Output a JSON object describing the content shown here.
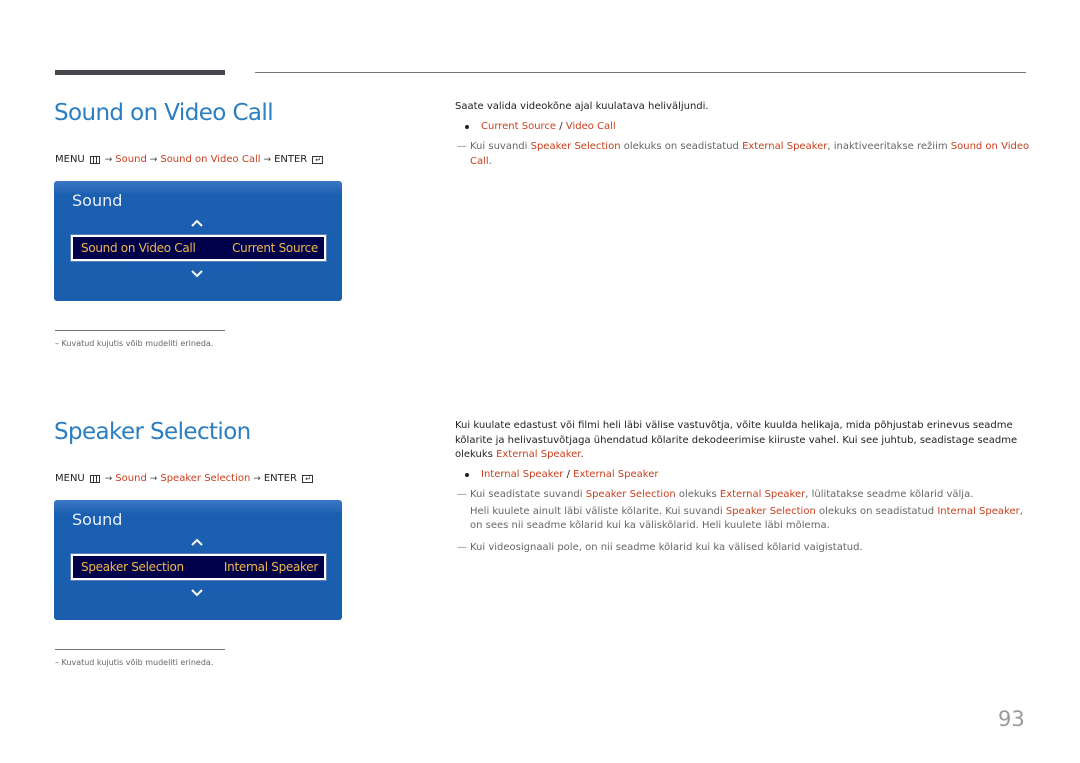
{
  "section1": {
    "title": "Sound on Video Call",
    "menu_path": {
      "menu": "MENU",
      "step1": "Sound",
      "step2": "Sound on Video Call",
      "enter": "ENTER"
    },
    "osd": {
      "title": "Sound",
      "item_label": "Sound on Video Call",
      "item_value": "Current Source"
    },
    "footnote": "–  Kuvatud kujutis võib mudeliti erineda.",
    "description": "Saate valida videokõne ajal kuulatava heliväljundi.",
    "options": [
      "Current Source",
      "Video Call"
    ],
    "options_sep": " / ",
    "note": {
      "p1": "Kui suvandi ",
      "h1": "Speaker Selection",
      "p2": " olekuks on seadistatud ",
      "h2": "External Speaker",
      "p3": ", inaktiveeritakse režiim ",
      "h3a": "Sound on Video",
      "h3b": "Call",
      "p4": "."
    }
  },
  "section2": {
    "title": "Speaker Selection",
    "menu_path": {
      "menu": "MENU",
      "step1": "Sound",
      "step2": "Speaker Selection",
      "enter": "ENTER"
    },
    "osd": {
      "title": "Sound",
      "item_label": "Speaker Selection",
      "item_value": "Internal Speaker"
    },
    "footnote": "–  Kuvatud kujutis võib mudeliti erineda.",
    "description": {
      "line1": "Kui kuulate edastust või filmi heli läbi välise vastuvõtja, võite kuulda helikaja, mida põhjustab erinevus seadme",
      "line2": "kõlarite ja helivastuvõtjaga ühendatud kõlarite dekodeerimise kiiruste vahel. Kui see juhtub, seadistage seadme",
      "line3_pre": "olekuks ",
      "line3_hl": "External Speaker",
      "line3_post": "."
    },
    "options": [
      "Internal Speaker",
      "External Speaker"
    ],
    "options_sep": " / ",
    "note1": {
      "p1": "Kui seadistate suvandi ",
      "h1": "Speaker Selection",
      "p2": " olekuks ",
      "h2": "External Speaker",
      "p3": ", lülitatakse seadme kõlarid välja.",
      "l2_p1": "Heli kuulete ainult läbi väliste kõlarite. Kui suvandi ",
      "l2_h1": "Speaker Selection",
      "l2_p2": " olekuks on seadistatud ",
      "l2_h2": "Internal Speaker",
      "l2_p3": ",",
      "l3": "on sees nii seadme kõlarid kui ka väliskõlarid. Heli kuulete läbi mõlema."
    },
    "note2": "Kui videosignaali pole, on nii seadme kõlarid kui ka välised kõlarid vaigistatud."
  },
  "page_number": "93",
  "colors": {
    "heading": "#2a7ec1",
    "highlight": "#c8401e",
    "osd_bg": "#1b5eae",
    "osd_item_bg": "#00004a",
    "osd_item_text": "#f0b84a"
  }
}
